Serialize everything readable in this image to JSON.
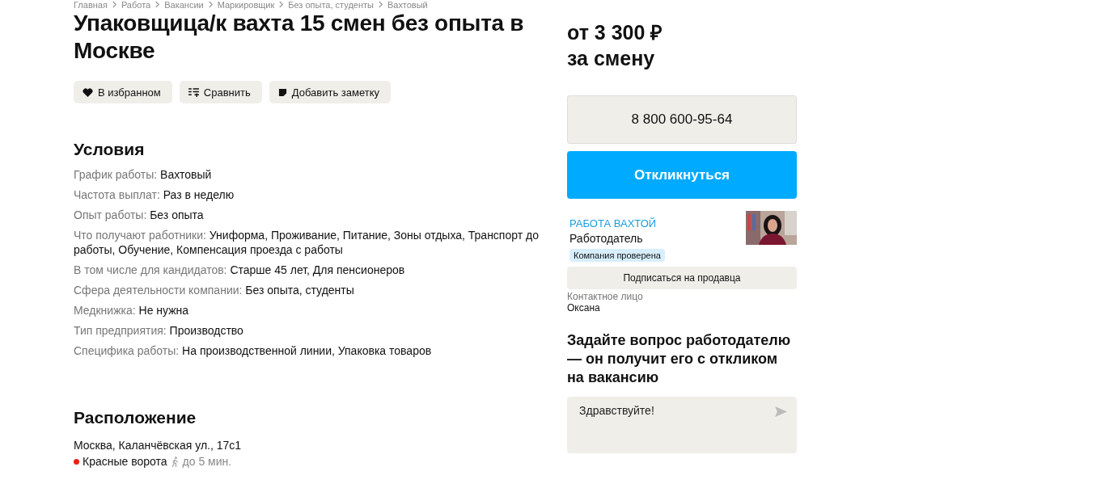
{
  "breadcrumbs": [
    "Главная",
    "Работа",
    "Вакансии",
    "Маркировщик",
    "Без опыта, студенты",
    "Вахтовый"
  ],
  "title": "Упаковщица/к вахта 15 смен без опыта в Москве",
  "actions": [
    {
      "kind": "favorite",
      "label": "В избранном"
    },
    {
      "kind": "compare",
      "label": "Сравнить"
    },
    {
      "kind": "note",
      "label": "Добавить заметку"
    }
  ],
  "conditions": {
    "heading": "Условия",
    "items": [
      {
        "label": "График работы:",
        "value": "Вахтовый"
      },
      {
        "label": "Частота выплат:",
        "value": "Раз в неделю"
      },
      {
        "label": "Опыт работы:",
        "value": "Без опыта"
      },
      {
        "label": "Что получают работники:",
        "value": "Униформа, Проживание, Питание, Зоны отдыха, Транспорт до работы, Обучение, Компенсация проезда с работы"
      },
      {
        "label": "В том числе для кандидатов:",
        "value": "Старше 45 лет, Для пенсионеров"
      },
      {
        "label": "Сфера деятельности компании:",
        "value": "Без опыта, студенты"
      },
      {
        "label": "Медкнижка:",
        "value": "Не нужна"
      },
      {
        "label": "Тип предприятия:",
        "value": "Производство"
      },
      {
        "label": "Специфика работы:",
        "value": "На производственной линии, Упаковка товаров"
      }
    ]
  },
  "location": {
    "heading": "Расположение",
    "address": "Москва, Каланчёвская ул., 17с1",
    "metro": {
      "station": "Красные ворота",
      "color": "#e42313",
      "walk": "до 5 мин."
    }
  },
  "salary": {
    "amount": "от 3 300 ₽",
    "period": "за смену"
  },
  "phone": "8 800 600-95-64",
  "apply_button": "Откликнуться",
  "seller": {
    "name": "РАБОТА ВАХТОЙ",
    "role": "Работодатель",
    "badge": "Компания проверена",
    "subscribe": "Подписаться на продавца",
    "contact_label": "Контактное лицо",
    "contact_name": "Оксана"
  },
  "question": {
    "heading": "Задайте вопрос работодателю — он получит его с откликом на вакансию",
    "message": "Здравствуйте!"
  }
}
